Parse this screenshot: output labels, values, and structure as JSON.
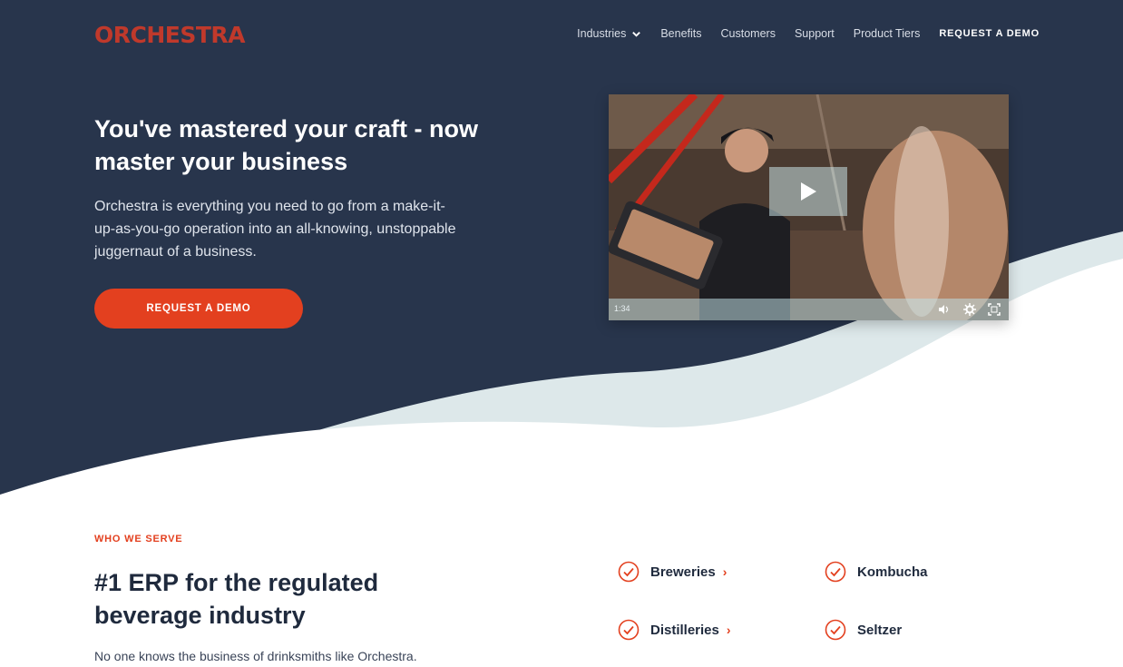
{
  "brand": {
    "logo": "ORCHESTRA",
    "accent": "#e3401f",
    "navy": "#28354c"
  },
  "nav": {
    "items": [
      "Industries",
      "Benefits",
      "Customers",
      "Support",
      "Product Tiers"
    ],
    "demo": "REQUEST A DEMO"
  },
  "hero": {
    "title": "You've mastered your craft - now master your business",
    "subtitle": "Orchestra is everything you need to go from a make-it-up-as-you-go operation into an all-knowing, unstoppable juggernaut of a business.",
    "cta": "REQUEST A DEMO"
  },
  "video": {
    "time": "1:34",
    "icons": [
      "play-icon",
      "volume-icon",
      "settings-icon",
      "fullscreen-icon"
    ]
  },
  "serve": {
    "eyebrow": "WHO WE SERVE",
    "title": "#1 ERP for the regulated beverage industry",
    "subtitle": "No one knows the business of drinksmiths like Orchestra.",
    "items": [
      {
        "label": "Breweries",
        "arrow": "›"
      },
      {
        "label": "Kombucha"
      },
      {
        "label": "Distilleries",
        "arrow": "›"
      },
      {
        "label": "Seltzer"
      }
    ]
  }
}
